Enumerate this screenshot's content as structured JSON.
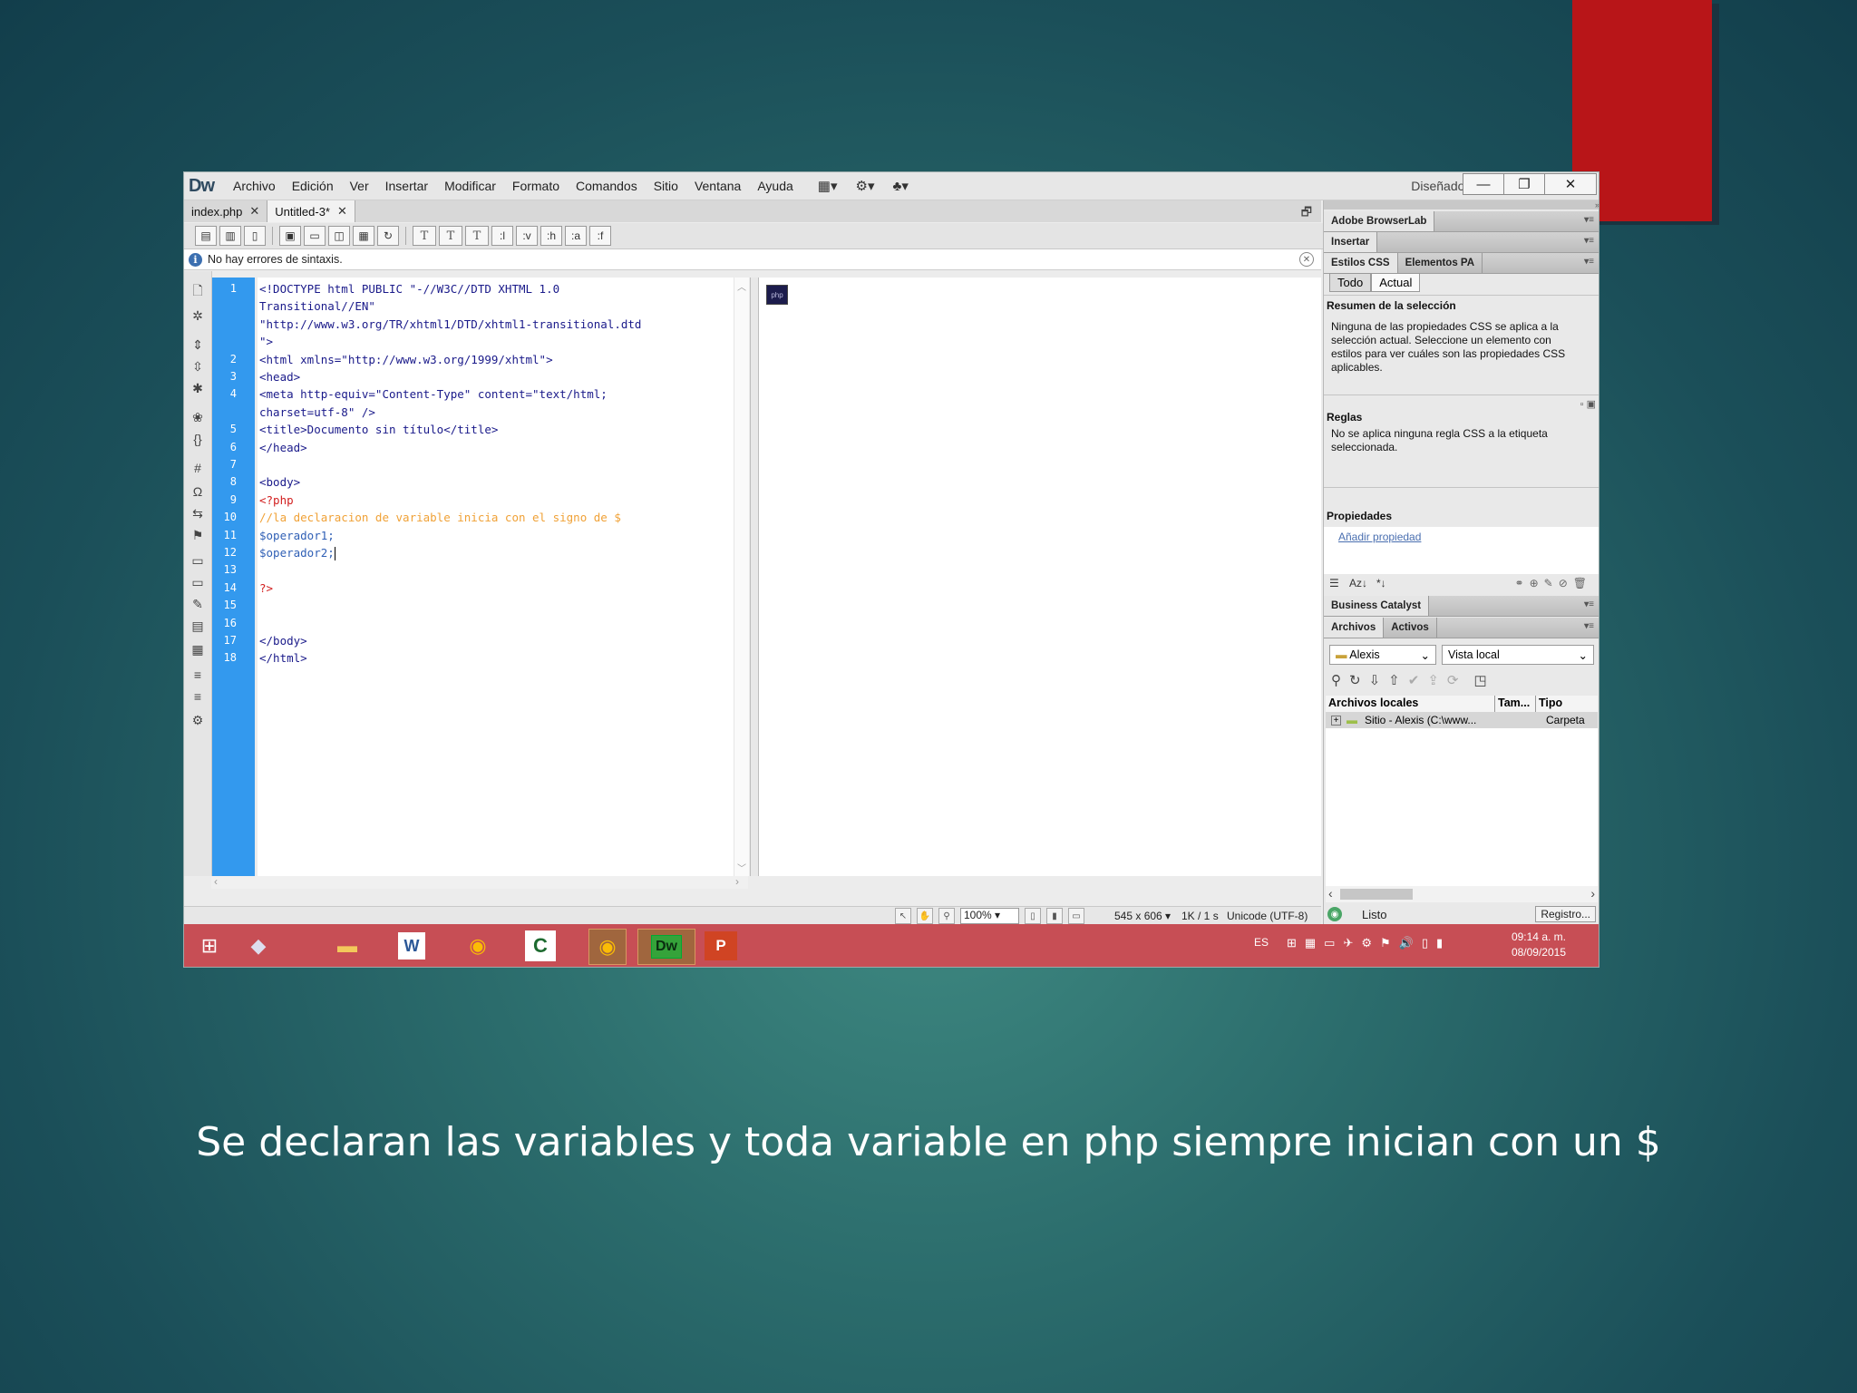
{
  "app": {
    "logo": "Dw",
    "menu": [
      "Archivo",
      "Edición",
      "Ver",
      "Insertar",
      "Modificar",
      "Formato",
      "Comandos",
      "Sitio",
      "Ventana",
      "Ayuda"
    ],
    "workspace": "Diseñador"
  },
  "tabs": [
    {
      "label": "index.php",
      "active": false
    },
    {
      "label": "Untitled-3*",
      "active": true
    }
  ],
  "toolbar": {
    "text_tools": [
      ":l",
      ":v",
      ":h",
      ":a",
      ":f"
    ]
  },
  "syntax_status": "No hay errores de sintaxis.",
  "editor": {
    "lines": [
      {
        "num": "1",
        "text": "<!DOCTYPE html PUBLIC \"-//W3C//DTD XHTML 1.0",
        "kind": "tag"
      },
      {
        "num": "",
        "text": "Transitional//EN\"",
        "kind": "tag"
      },
      {
        "num": "",
        "text": "\"http://www.w3.org/TR/xhtml1/DTD/xhtml1-transitional.dtd",
        "kind": "tag"
      },
      {
        "num": "",
        "text": "\">",
        "kind": "tag"
      },
      {
        "num": "2",
        "text": "<html xmlns=\"http://www.w3.org/1999/xhtml\">",
        "kind": "tag"
      },
      {
        "num": "3",
        "text": "<head>",
        "kind": "tag"
      },
      {
        "num": "4",
        "text": "<meta http-equiv=\"Content-Type\" content=\"text/html;",
        "kind": "tag"
      },
      {
        "num": "",
        "text": "charset=utf-8\" />",
        "kind": "tag"
      },
      {
        "num": "5",
        "text": "<title>Documento sin título</title>",
        "kind": "tag"
      },
      {
        "num": "6",
        "text": "</head>",
        "kind": "tag"
      },
      {
        "num": "7",
        "text": "",
        "kind": "tag"
      },
      {
        "num": "8",
        "text": "<body>",
        "kind": "tag"
      },
      {
        "num": "9",
        "text": "<?php",
        "kind": "php"
      },
      {
        "num": "10",
        "text": "//la declaracion de variable inicia con el signo de $",
        "kind": "cmt"
      },
      {
        "num": "11",
        "text": "$operador1;",
        "kind": "var"
      },
      {
        "num": "12",
        "text": "$operador2;",
        "kind": "var"
      },
      {
        "num": "13",
        "text": "",
        "kind": "tag"
      },
      {
        "num": "14",
        "text": "?>",
        "kind": "php"
      },
      {
        "num": "15",
        "text": "",
        "kind": "tag"
      },
      {
        "num": "16",
        "text": "",
        "kind": "tag"
      },
      {
        "num": "17",
        "text": "</body>",
        "kind": "tag"
      },
      {
        "num": "18",
        "text": "</html>",
        "kind": "tag"
      }
    ]
  },
  "statusbar": {
    "zoom": "100%",
    "size": "545 x 606",
    "download": "1K / 1 s",
    "encoding": "Unicode (UTF-8)"
  },
  "panels": {
    "browserlab": "Adobe BrowserLab",
    "insertar": "Insertar",
    "css_tab": "Estilos CSS",
    "pa_tab": "Elementos PA",
    "mode_all": "Todo",
    "mode_current": "Actual",
    "summary_title": "Resumen de la selección",
    "summary_text": "Ninguna de las propiedades CSS se aplica a la selección actual.  Seleccione un elemento con estilos para ver cuáles son las propiedades CSS aplicables.",
    "rules_title": "Reglas",
    "rules_text": "No se aplica ninguna regla CSS a la etiqueta seleccionada.",
    "props_title": "Propiedades",
    "add_prop": "Añadir propiedad",
    "business": "Business Catalyst",
    "files_tab": "Archivos",
    "assets_tab": "Activos",
    "site_select": "Alexis",
    "view_select": "Vista local",
    "col_local": "Archivos locales",
    "col_size": "Tam...",
    "col_type": "Tipo",
    "row_name": "Sitio - Alexis (C:\\www...",
    "row_type": "Carpeta",
    "ready": "Listo",
    "log": "Registro..."
  },
  "taskbar": {
    "lang": "ES",
    "time": "09:14 a. m.",
    "date": "08/09/2015"
  },
  "caption": "Se declaran las variables y toda variable en php siempre inician con un $"
}
